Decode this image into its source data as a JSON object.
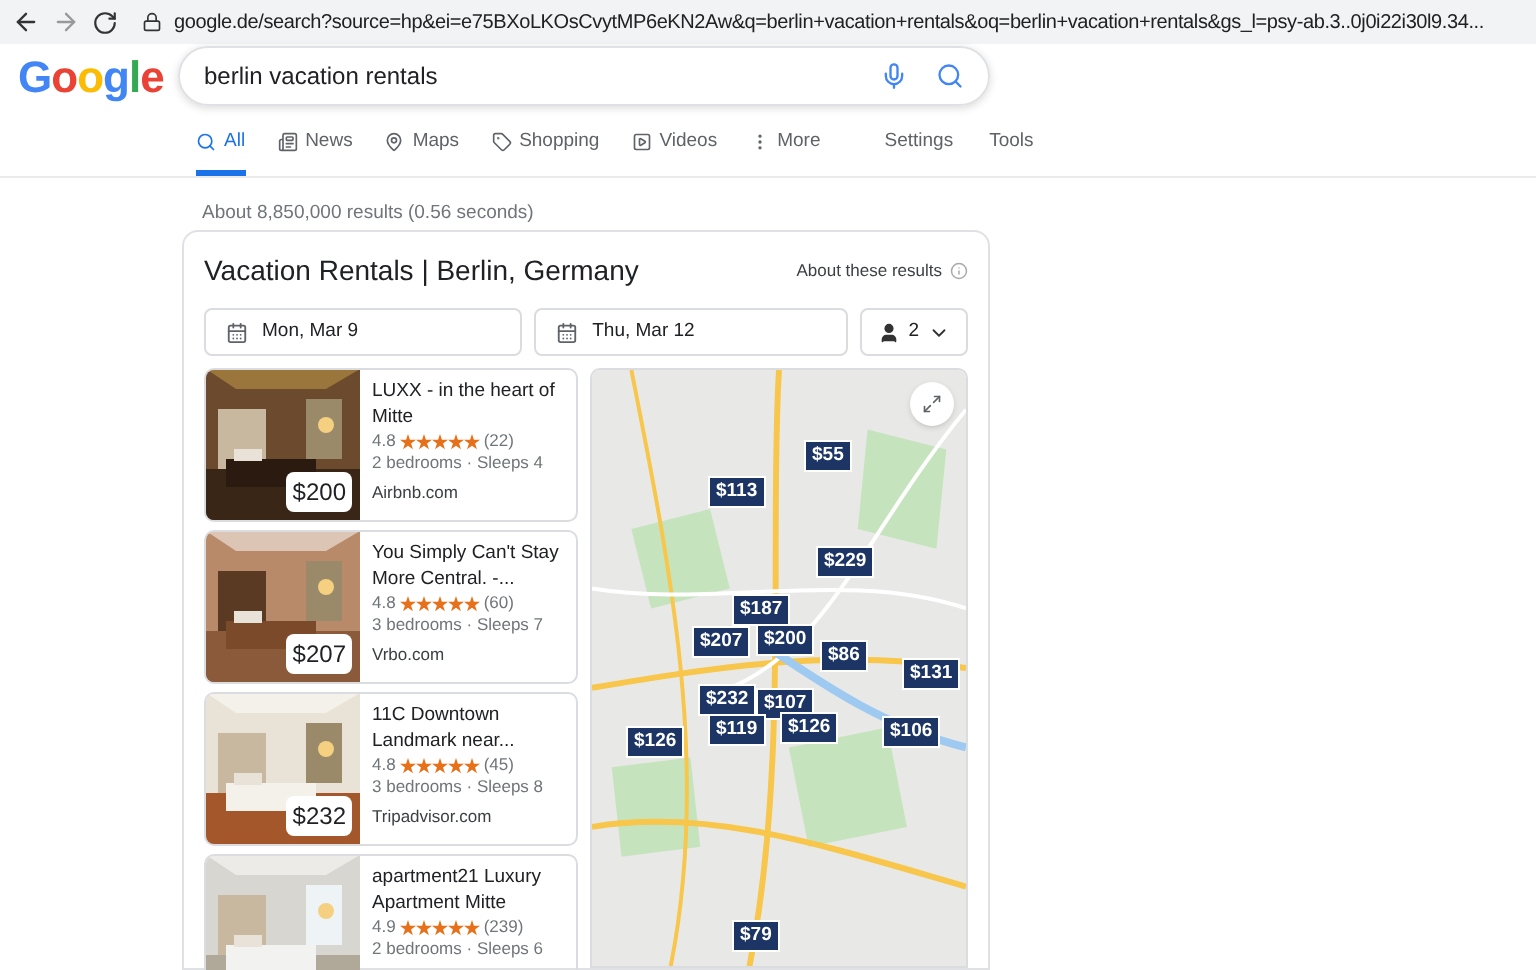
{
  "browser": {
    "url": "google.de/search?source=hp&ei=e75BXoLKOsCvytMP6eKN2Aw&q=berlin+vacation+rentals&oq=berlin+vacation+rentals&gs_l=psy-ab.3..0j0i22i30l9.34..."
  },
  "logo": "Google",
  "search": {
    "value": "berlin vacation rentals"
  },
  "tabs": [
    {
      "label": "All",
      "kind": "search",
      "selected": true
    },
    {
      "label": "News",
      "kind": "news",
      "selected": false
    },
    {
      "label": "Maps",
      "kind": "maps",
      "selected": false
    },
    {
      "label": "Shopping",
      "kind": "shopping",
      "selected": false
    },
    {
      "label": "Videos",
      "kind": "videos",
      "selected": false
    },
    {
      "label": "More",
      "kind": "more",
      "selected": false
    }
  ],
  "tools": [
    "Settings",
    "Tools"
  ],
  "result_stats": "About 8,850,000 results (0.56 seconds)",
  "card": {
    "title": "Vacation Rentals | Berlin, Germany",
    "about": "About these results",
    "check_in": "Mon, Mar 9",
    "check_out": "Thu, Mar 12",
    "guests": "2",
    "listings": [
      {
        "price": "$200",
        "title": "LUXX - in the heart of Mitte",
        "rating": "4.8",
        "stars": 5,
        "reviews": "(22)",
        "details": "2 bedrooms · Sleeps 4",
        "source": "Airbnb.com"
      },
      {
        "price": "$207",
        "title": "You Simply Can't Stay More Central. -...",
        "rating": "4.8",
        "stars": 5,
        "reviews": "(60)",
        "details": "3 bedrooms · Sleeps 7",
        "source": "Vrbo.com"
      },
      {
        "price": "$232",
        "title": "11C Downtown Landmark near...",
        "rating": "4.8",
        "stars": 5,
        "reviews": "(45)",
        "details": "3 bedrooms · Sleeps 8",
        "source": "Tripadvisor.com"
      },
      {
        "title": "apartment21 Luxury Apartment Mitte",
        "rating": "4.9",
        "stars": 5,
        "reviews": "(239)",
        "details": "2 bedrooms · Sleeps 6"
      }
    ],
    "map_pins": [
      {
        "label": "$55"
      },
      {
        "label": "$113"
      },
      {
        "label": "$229"
      },
      {
        "label": "$187"
      },
      {
        "label": "$207"
      },
      {
        "label": "$200"
      },
      {
        "label": "$86"
      },
      {
        "label": "$131"
      },
      {
        "label": "$232"
      },
      {
        "label": "$107"
      },
      {
        "label": "$119"
      },
      {
        "label": "$126"
      },
      {
        "label": "$126"
      },
      {
        "label": "$106"
      },
      {
        "label": "$79"
      }
    ]
  }
}
